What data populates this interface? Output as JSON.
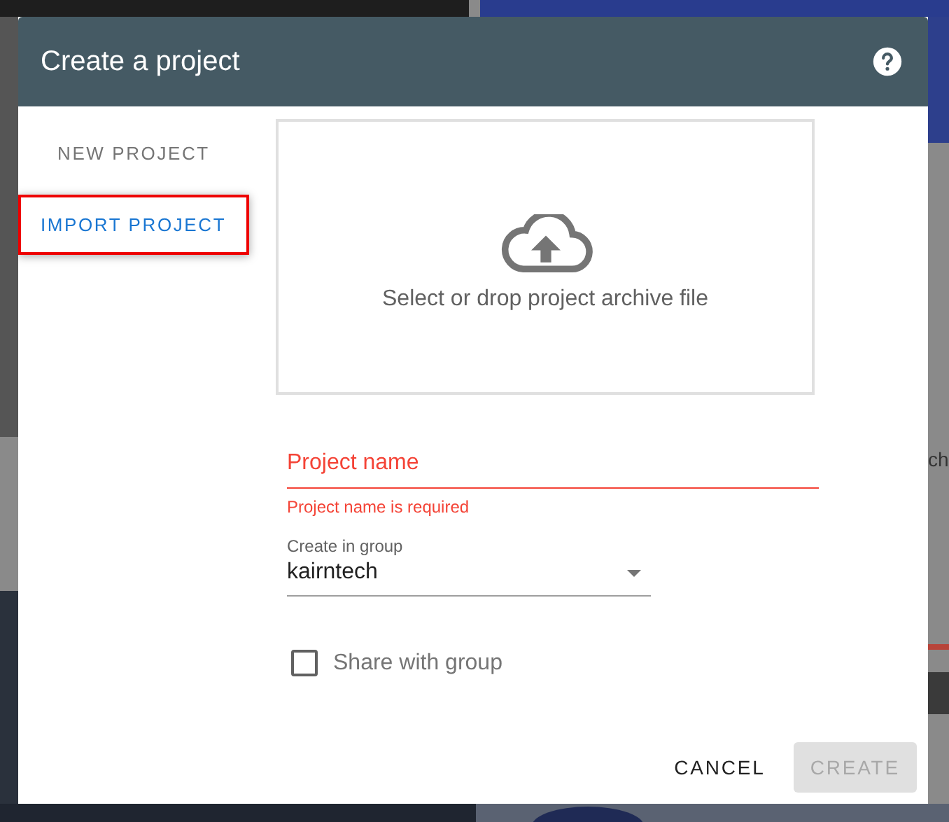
{
  "backdrop": {
    "kind": "picture",
    "text": "ch"
  },
  "dialog": {
    "title": "Create a project"
  },
  "tabs": [
    {
      "label": "NEW PROJECT",
      "selected": false,
      "highlighted": false
    },
    {
      "label": "IMPORT PROJECT",
      "selected": true,
      "highlighted": true
    }
  ],
  "upload": {
    "text": "Select or drop project archive file"
  },
  "project_name": {
    "placeholder": "Project name",
    "error": "Project name is required"
  },
  "group_select": {
    "label": "Create in group",
    "value": "kairntech"
  },
  "share": {
    "label": "Share with group",
    "checked": false
  },
  "buttons": [
    {
      "label": "CANCEL",
      "disabled": false
    },
    {
      "label": "CREATE",
      "disabled": true
    }
  ]
}
